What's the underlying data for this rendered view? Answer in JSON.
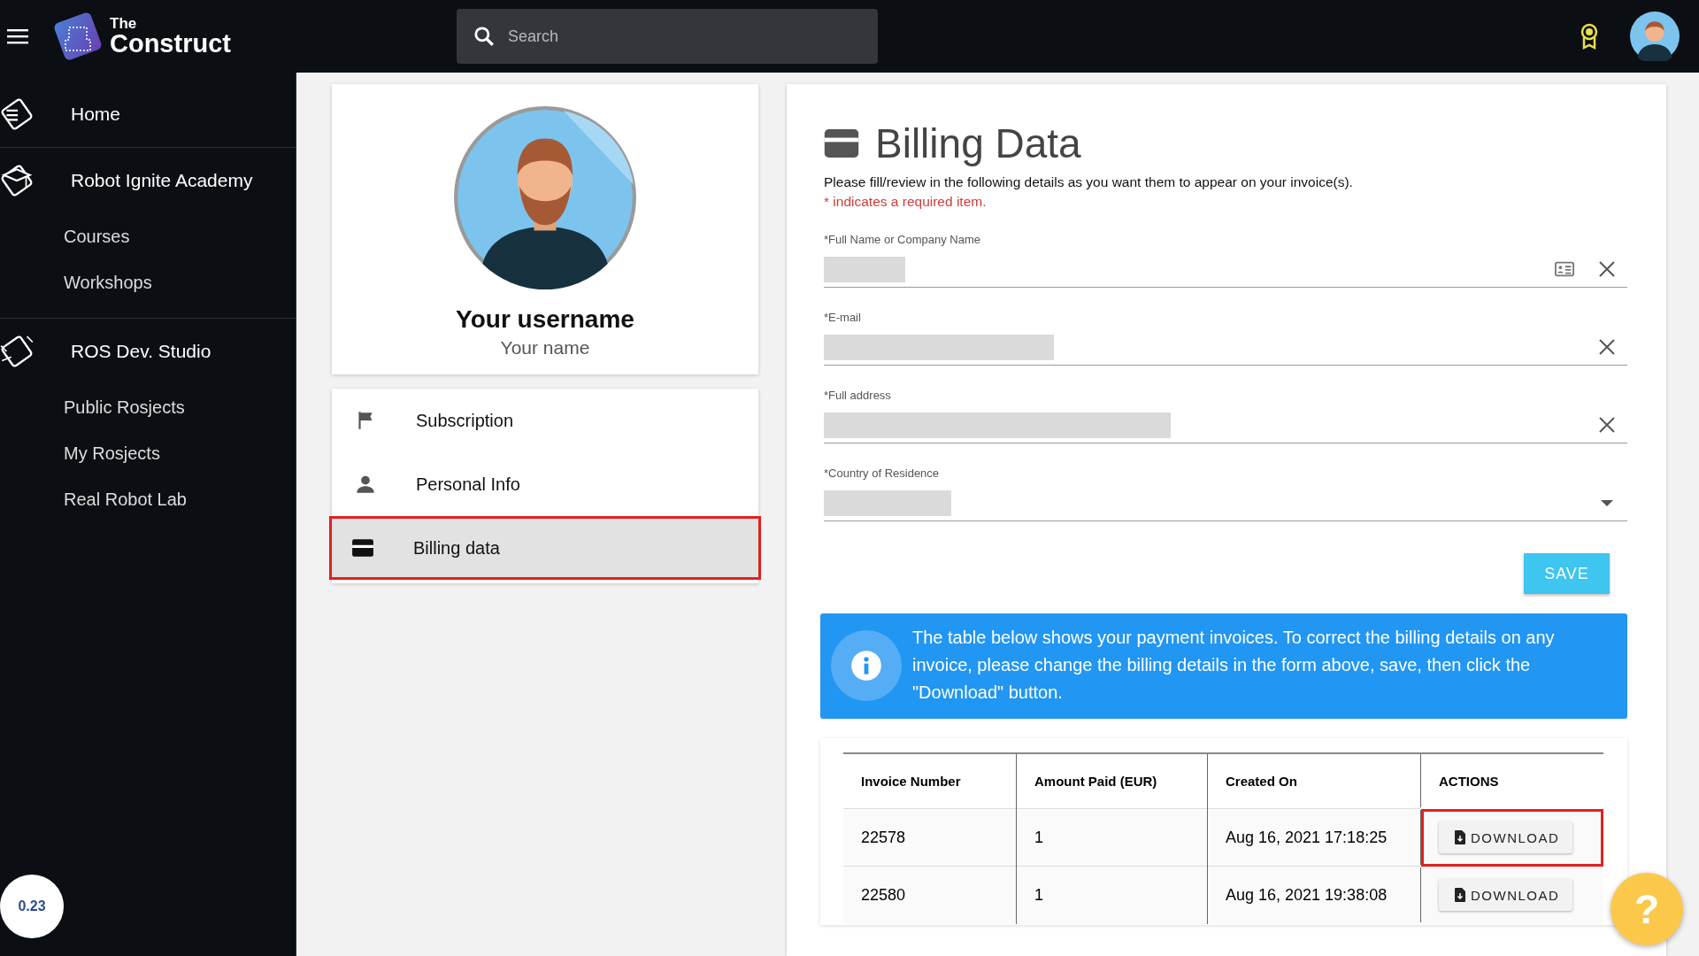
{
  "header": {
    "logo": {
      "small": "The",
      "large": "Construct"
    },
    "search": {
      "placeholder": "Search"
    }
  },
  "sidebar": [
    {
      "label": "Home",
      "kind": "home"
    },
    {
      "label": "Robot Ignite Academy",
      "kind": "academy",
      "children": [
        {
          "label": "Courses"
        },
        {
          "label": "Workshops"
        }
      ]
    },
    {
      "label": "ROS Dev. Studio",
      "kind": "studio",
      "children": [
        {
          "label": "Public Rosjects"
        },
        {
          "label": "My Rosjects"
        },
        {
          "label": "Real Robot Lab"
        }
      ]
    }
  ],
  "version_badge": "0.23",
  "profile": {
    "username": "Your username",
    "name": "Your name"
  },
  "profile_menu": [
    {
      "label": "Subscription",
      "kind": "flag",
      "selected": false,
      "highlighted": false
    },
    {
      "label": "Personal Info",
      "kind": "person",
      "selected": false,
      "highlighted": false
    },
    {
      "label": "Billing data",
      "kind": "card",
      "selected": true,
      "highlighted": true
    }
  ],
  "billing": {
    "title": "Billing Data",
    "intro": "Please fill/review in the following details as you want them to appear on your invoice(s).",
    "required_note": "* indicates a required item.",
    "fields": [
      {
        "label": "*Full Name or Company Name",
        "kind": "contact"
      },
      {
        "label": "*E-mail",
        "kind": "text"
      },
      {
        "label": "*Full address",
        "kind": "text"
      },
      {
        "label": "*Country of Residence",
        "kind": "select"
      }
    ],
    "save_button": "SAVE",
    "info": "The table below shows your payment invoices. To correct the billing details on any invoice, please change the billing details in the form above, save, then click the \"Download\" button.",
    "table": {
      "columns": [
        "Invoice Number",
        "Amount Paid (EUR)",
        "Created On",
        "ACTIONS"
      ],
      "rows": [
        {
          "cells": [
            "22578",
            "1",
            "Aug 16, 2021 17:18:25"
          ],
          "action": "DOWNLOAD",
          "highlighted": true
        },
        {
          "cells": [
            "22580",
            "1",
            "Aug 16, 2021 19:38:08"
          ],
          "action": "DOWNLOAD",
          "highlighted": false
        }
      ]
    }
  },
  "help_button": "?"
}
